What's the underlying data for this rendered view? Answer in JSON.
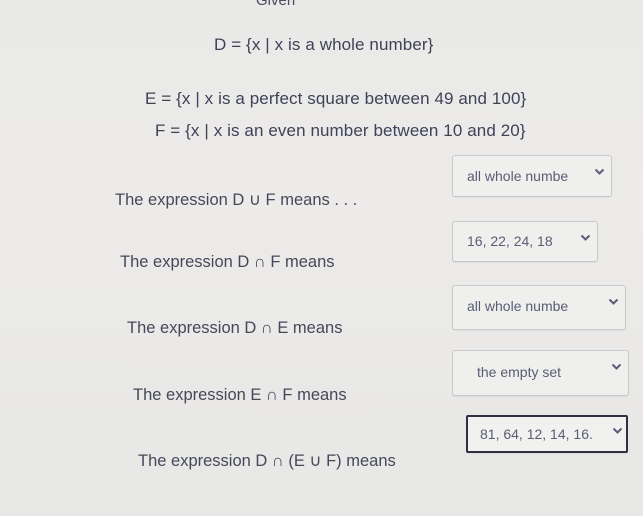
{
  "header": {
    "title": "Given"
  },
  "sets": [
    {
      "name": "D",
      "definition": "D = {x | x is a whole number}"
    },
    {
      "name": "E",
      "definition": "E = {x | x is a perfect square between 49 and 100}"
    },
    {
      "name": "F",
      "definition": "F = {x | x is an even number between 10 and 20}"
    }
  ],
  "questions": [
    {
      "label": "The expression D ∪ F means . . .",
      "selected": "all whole numbe",
      "icon": "chevron-down-icon",
      "focused": false
    },
    {
      "label": "The expression D ∩ F means",
      "selected": "16, 22, 24, 18",
      "icon": "chevron-down-icon",
      "focused": false
    },
    {
      "label": "The expression D ∩ E means",
      "selected": "all whole numbe",
      "icon": "chevron-down-icon",
      "focused": false
    },
    {
      "label": "The expression E ∩ F means",
      "selected": "the empty set",
      "icon": "chevron-down-icon",
      "focused": false
    },
    {
      "label": "The expression D ∩ (E ∪ F) means",
      "selected": "81, 64, 12, 14, 16.",
      "icon": "chevron-down-icon",
      "focused": true
    }
  ]
}
